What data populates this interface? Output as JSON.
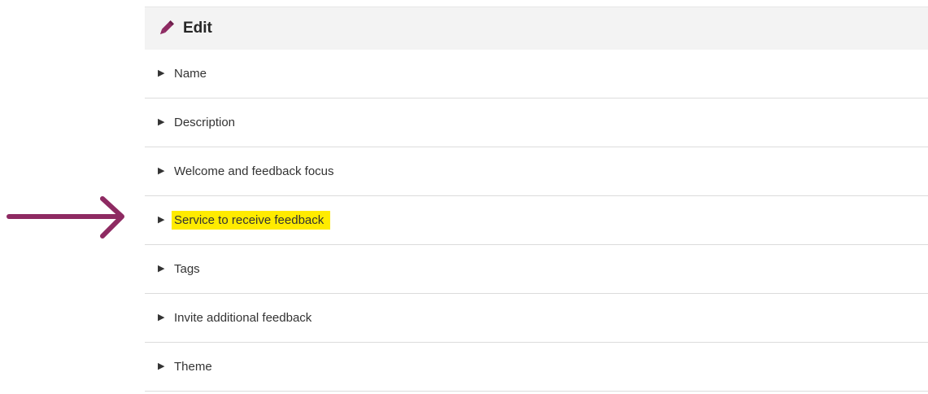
{
  "panel": {
    "title": "Edit",
    "title_icon": "pencil-icon",
    "sections": [
      {
        "label": "Name",
        "highlighted": false
      },
      {
        "label": "Description",
        "highlighted": false
      },
      {
        "label": "Welcome and feedback focus",
        "highlighted": false
      },
      {
        "label": "Service to receive feedback",
        "highlighted": true
      },
      {
        "label": "Tags",
        "highlighted": false
      },
      {
        "label": "Invite additional feedback",
        "highlighted": false
      },
      {
        "label": "Theme",
        "highlighted": false
      }
    ],
    "expand_icon": "triangle-right-icon"
  },
  "annotation": {
    "icon": "arrow-right-icon",
    "color": "#8e2a62"
  },
  "colors": {
    "highlight": "#ffeb00",
    "accent": "#8e2a62",
    "header_bg": "#f3f3f3"
  }
}
